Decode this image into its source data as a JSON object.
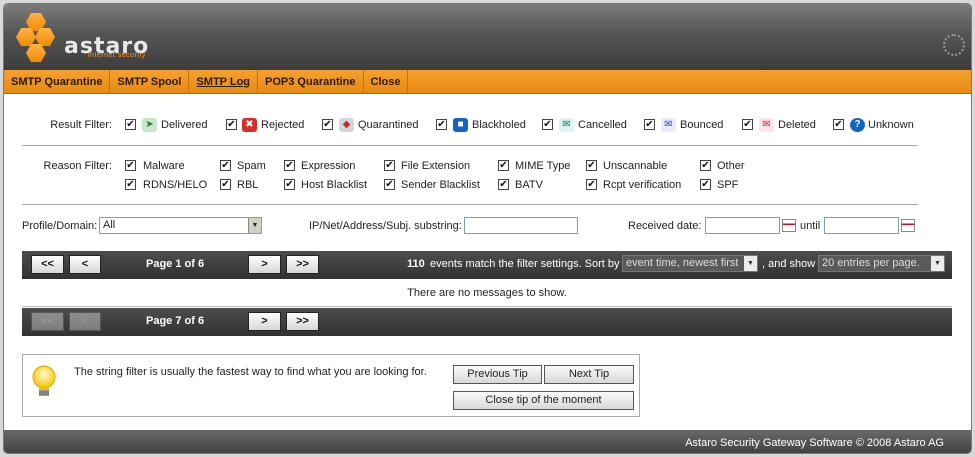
{
  "app": {
    "logo_text": "astaro",
    "logo_subtext": "internet security"
  },
  "tabs": [
    "SMTP Quarantine",
    "SMTP Spool",
    "SMTP Log",
    "POP3 Quarantine",
    "Close"
  ],
  "filters": {
    "result_label": "Result Filter:",
    "result_items": [
      "Delivered",
      "Rejected",
      "Quarantined",
      "Blackholed",
      "Cancelled",
      "Bounced",
      "Deleted",
      "Unknown"
    ],
    "reason_label": "Reason Filter:",
    "reason_row1": [
      "Malware",
      "Spam",
      "Expression",
      "File Extension",
      "MIME Type",
      "Unscannable",
      "Other"
    ],
    "reason_row2": [
      "RDNS/HELO",
      "RBL",
      "Host Blacklist",
      "Sender Blacklist",
      "BATV",
      "Rcpt verification",
      "SPF"
    ],
    "check_mark": "✔"
  },
  "search": {
    "profile_label": "Profile/Domain:",
    "profile_value": "All",
    "substring_label": "IP/Net/Address/Subj. substring:",
    "substring_value": "",
    "received_label": "Received date:",
    "until_label": "until"
  },
  "pager": {
    "first": "<<",
    "prev": "<",
    "next": ">",
    "last": ">>",
    "page_info_top": "Page 1 of 6",
    "page_info_bottom": "Page 7 of 6",
    "event_count": "110",
    "match_text": "events match the filter settings. Sort by",
    "sort_value": "event time, newest first",
    "show_text": ", and show",
    "per_page_value": "20 entries per page."
  },
  "messages": {
    "empty": "There are no messages to show."
  },
  "tip": {
    "text": "The string filter is usually the fastest way to find what you are looking for.",
    "prev_label": "Previous Tip",
    "next_label": "Next Tip",
    "close_label": "Close tip of the moment"
  },
  "footer": {
    "text": "Astaro Security Gateway Software  © 2008 Astaro AG"
  }
}
